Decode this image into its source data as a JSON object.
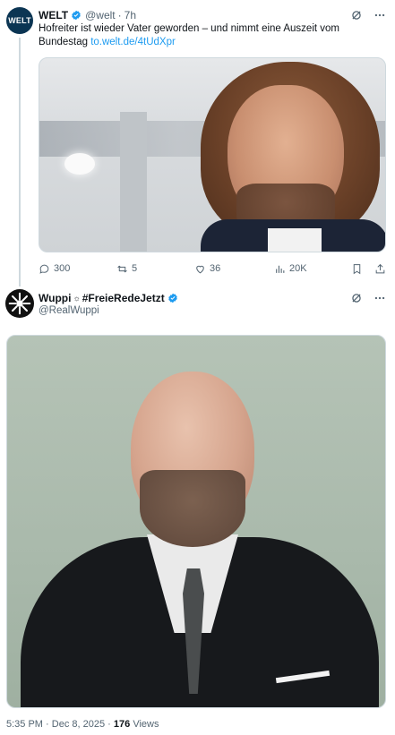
{
  "parent_tweet": {
    "avatar_text": "WELT",
    "name": "WELT",
    "handle": "@welt",
    "separator": "·",
    "time": "7h",
    "text": "Hofreiter ist wieder Vater geworden – und nimmt eine Auszeit vom Bundestag ",
    "link": "to.welt.de/4tUdXpr",
    "actions": {
      "replies": "300",
      "reposts": "5",
      "likes": "36",
      "views": "20K"
    }
  },
  "main_tweet": {
    "name": "Wuppi",
    "name_symbol": "☼",
    "name_tag": "#FreieRedeJetzt",
    "handle": "@RealWuppi"
  },
  "footer": {
    "time": "5:35 PM",
    "separator1": "·",
    "date": "Dec 8, 2025",
    "separator2": "·",
    "views_count": "176",
    "views_label": "Views"
  },
  "colors": {
    "verified": "#1d9bf0",
    "link": "#1d9bf0",
    "muted": "#536471",
    "text": "#0f1419",
    "thread_line": "#cfd9de"
  },
  "icons": [
    "verified-icon",
    "grok-icon",
    "more-icon",
    "reply-icon",
    "repost-icon",
    "like-icon",
    "views-icon",
    "bookmark-icon",
    "share-icon"
  ]
}
